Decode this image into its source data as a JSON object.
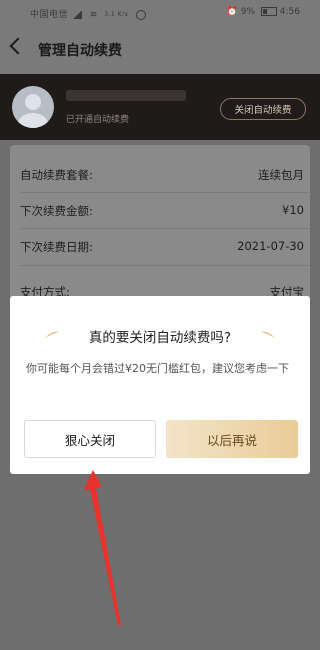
{
  "status_bar": {
    "carrier": "中国电信",
    "network_speed": "3.1 K/s",
    "battery_text": "9%",
    "time": "4:56"
  },
  "header": {
    "title": "管理自动续费"
  },
  "profile": {
    "status": "已开通自动续费",
    "close_button": "关闭自动续费"
  },
  "details": {
    "rows": [
      {
        "label": "自动续费套餐:",
        "value": "连续包月"
      },
      {
        "label": "下次续费金额:",
        "value": "¥10"
      },
      {
        "label": "下次续费日期:",
        "value": "2021-07-30"
      },
      {
        "label": "支付方式:",
        "value": "支付宝"
      }
    ]
  },
  "dialog": {
    "title": "真的要关闭自动续费吗?",
    "message": "你可能每个月会错过¥20无门槛红包，建议您考虑一下",
    "cancel_label": "狠心关闭",
    "keep_label": "以后再说"
  },
  "colors": {
    "overlay": "#6e6e6e",
    "profile_bg": "#1f1b1a",
    "gold_button": "#e9cc98",
    "annotation_arrow": "#e8322c"
  }
}
